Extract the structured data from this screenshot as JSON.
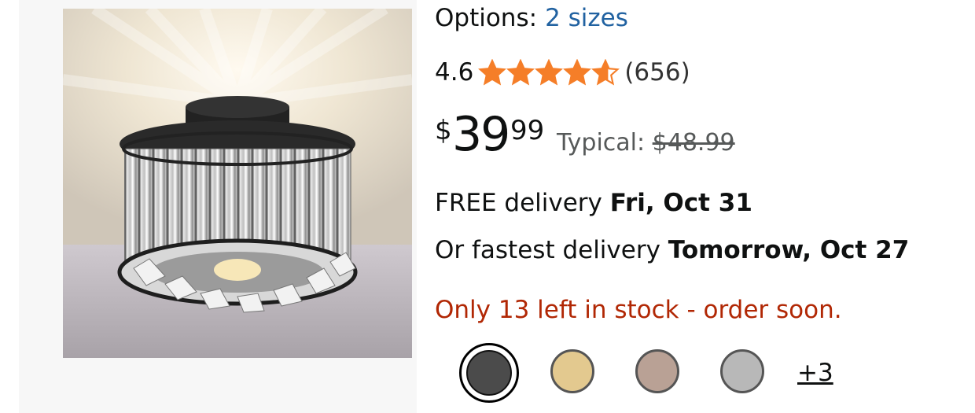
{
  "product": {
    "options_label": "Options:",
    "options_value": "2 sizes",
    "rating_value": "4.6",
    "rating_stars": 4.6,
    "review_count": "(656)",
    "price_currency": "$",
    "price_whole": "39",
    "price_cents": "99",
    "typical_label": "Typical:",
    "typical_price": "$48.99"
  },
  "delivery": {
    "free_label": "FREE delivery",
    "free_date": "Fri, Oct 31",
    "fast_label": "Or fastest delivery",
    "fast_date": "Tomorrow, Oct 27"
  },
  "stock": {
    "message": "Only 13 left in stock - order soon."
  },
  "swatches": {
    "colors": [
      "#4b4b4b",
      "#e3c98f",
      "#b9a195",
      "#b8b8b8"
    ],
    "selected_index": 0,
    "more_label": "+3"
  },
  "colors": {
    "link": "#2162a1",
    "star": "#f57e28",
    "stock": "#b12704",
    "muted": "#565959"
  }
}
